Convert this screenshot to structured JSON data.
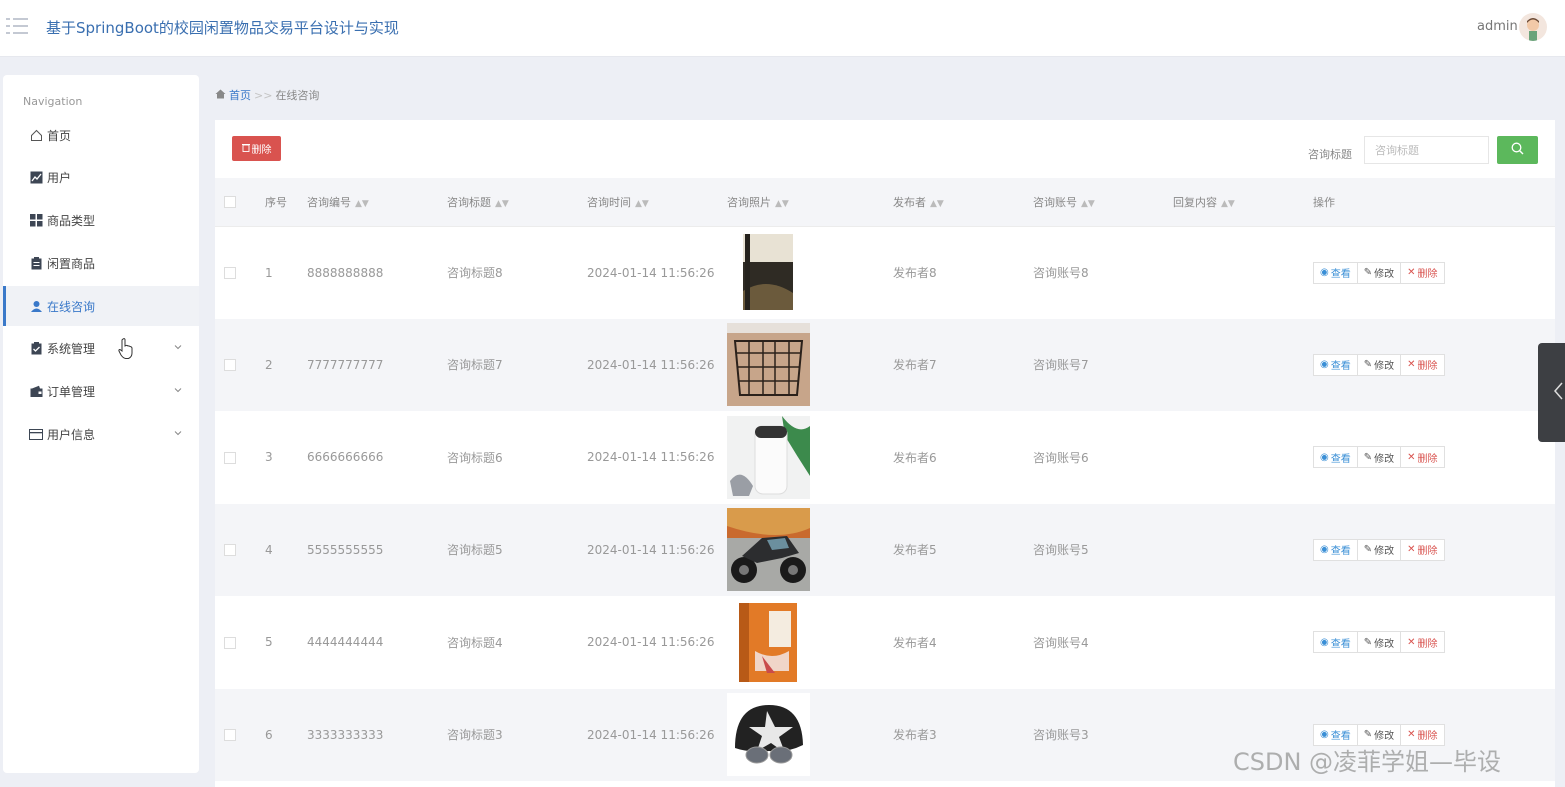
{
  "header": {
    "title": "基于SpringBoot的校园闲置物品交易平台设计与实现",
    "username": "admin",
    "menu_icon": "menu-icon",
    "avatar_icon": "avatar"
  },
  "sidebar": {
    "heading": "Navigation",
    "items": [
      {
        "label": "首页",
        "icon": "home-icon",
        "expandable": false,
        "active": false
      },
      {
        "label": "用户",
        "icon": "chart-icon",
        "expandable": false,
        "active": false
      },
      {
        "label": "商品类型",
        "icon": "grid-icon",
        "expandable": false,
        "active": false
      },
      {
        "label": "闲置商品",
        "icon": "clipboard-icon",
        "expandable": false,
        "active": false
      },
      {
        "label": "在线咨询",
        "icon": "user-icon",
        "expandable": false,
        "active": true
      },
      {
        "label": "系统管理",
        "icon": "checklist-icon",
        "expandable": true,
        "active": false
      },
      {
        "label": "订单管理",
        "icon": "wallet-icon",
        "expandable": true,
        "active": false
      },
      {
        "label": "用户信息",
        "icon": "card-icon",
        "expandable": true,
        "active": false
      }
    ]
  },
  "breadcrumb": {
    "home": "首页",
    "separator": ">>",
    "current": "在线咨询"
  },
  "toolbar": {
    "delete_label": "删除",
    "search_label": "咨询标题",
    "search_placeholder": "咨询标题",
    "search_value": ""
  },
  "table": {
    "headers": [
      "序号",
      "咨询编号",
      "咨询标题",
      "咨询时间",
      "咨询照片",
      "发布者",
      "咨询账号",
      "回复内容",
      "操作"
    ],
    "sortable": [
      false,
      true,
      true,
      true,
      true,
      true,
      true,
      true,
      false
    ],
    "action_labels": {
      "view": "查看",
      "edit": "修改",
      "delete": "删除"
    },
    "rows": [
      {
        "index": "1",
        "code": "8888888888",
        "title": "咨询标题8",
        "time": "2024-01-14 11:56:26",
        "photo": "book-cover",
        "publisher": "发布者8",
        "account": "咨询账号8",
        "reply": ""
      },
      {
        "index": "2",
        "code": "7777777777",
        "title": "咨询标题7",
        "time": "2024-01-14 11:56:26",
        "photo": "wire-basket",
        "publisher": "发布者7",
        "account": "咨询账号7",
        "reply": ""
      },
      {
        "index": "3",
        "code": "6666666666",
        "title": "咨询标题6",
        "time": "2024-01-14 11:56:26",
        "photo": "air-purifier",
        "publisher": "发布者6",
        "account": "咨询账号6",
        "reply": ""
      },
      {
        "index": "4",
        "code": "5555555555",
        "title": "咨询标题5",
        "time": "2024-01-14 11:56:26",
        "photo": "motorcycle",
        "publisher": "发布者5",
        "account": "咨询账号5",
        "reply": ""
      },
      {
        "index": "5",
        "code": "4444444444",
        "title": "咨询标题4",
        "time": "2024-01-14 11:56:26",
        "photo": "book-orange",
        "publisher": "发布者4",
        "account": "咨询账号4",
        "reply": ""
      },
      {
        "index": "6",
        "code": "3333333333",
        "title": "咨询标题3",
        "time": "2024-01-14 11:56:26",
        "photo": "helmet",
        "publisher": "发布者3",
        "account": "咨询账号3",
        "reply": ""
      }
    ]
  },
  "watermark": "CSDN @凌菲学姐—毕设",
  "colors": {
    "accent": "#3a79c9",
    "danger": "#d9534f",
    "success": "#5cb85c",
    "background": "#edeff5"
  }
}
